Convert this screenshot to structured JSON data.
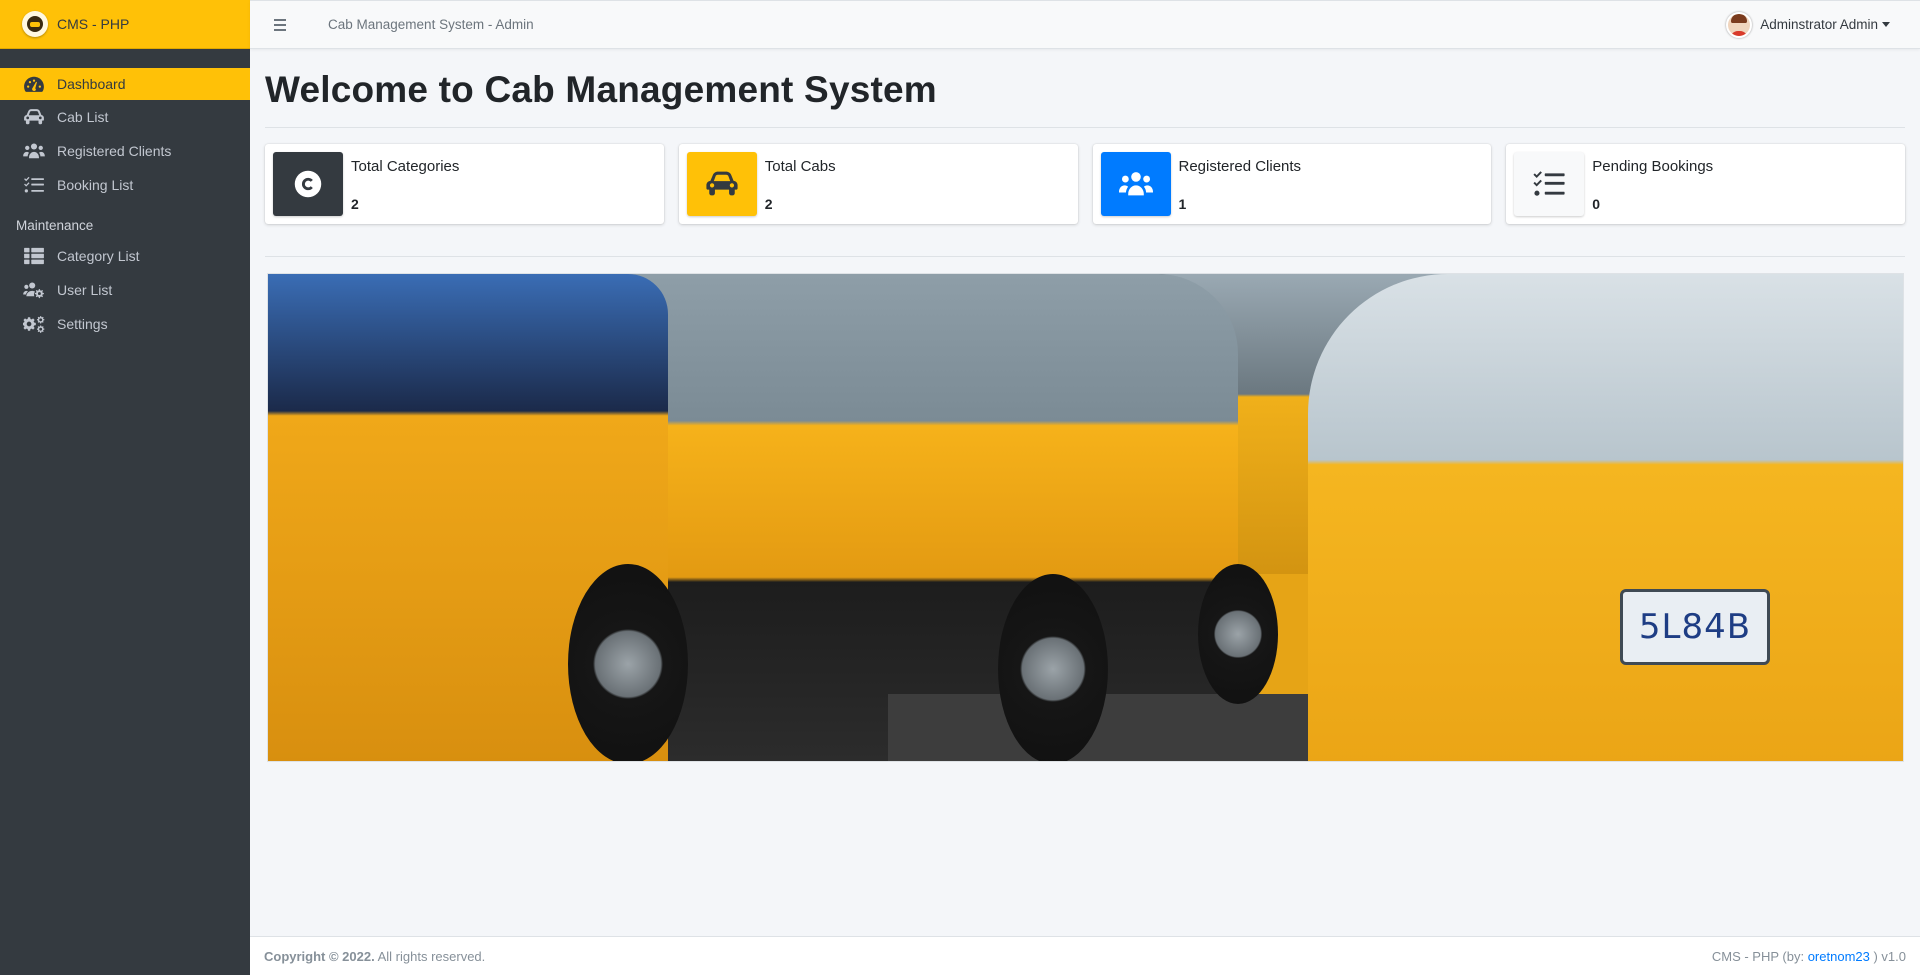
{
  "brand": {
    "name": "CMS - PHP"
  },
  "sidebar": {
    "items": [
      {
        "label": "Dashboard",
        "icon": "tachometer-icon",
        "active": true
      },
      {
        "label": "Cab List",
        "icon": "car-icon"
      },
      {
        "label": "Registered Clients",
        "icon": "users-icon"
      },
      {
        "label": "Booking List",
        "icon": "tasks-icon"
      }
    ],
    "section_header": "Maintenance",
    "maintenance_items": [
      {
        "label": "Category List",
        "icon": "th-list-icon"
      },
      {
        "label": "User List",
        "icon": "users-cog-icon"
      },
      {
        "label": "Settings",
        "icon": "cogs-icon"
      }
    ]
  },
  "topbar": {
    "title": "Cab Management System - Admin",
    "user_name": "Adminstrator Admin"
  },
  "main": {
    "page_title": "Welcome to Cab Management System",
    "info_boxes": [
      {
        "label": "Total Categories",
        "value": "2",
        "icon": "copyright-icon",
        "color": "#343a40"
      },
      {
        "label": "Total Cabs",
        "value": "2",
        "icon": "car-icon",
        "color": "#ffc107"
      },
      {
        "label": "Registered Clients",
        "value": "1",
        "icon": "users-icon",
        "color": "#007bff"
      },
      {
        "label": "Pending Bookings",
        "value": "0",
        "icon": "tasks-icon",
        "color": "#f8f9fa"
      }
    ],
    "banner": {
      "plate_text": "5L84B"
    }
  },
  "footer": {
    "copyright_strong": "Copyright © 2022.",
    "copyright_rest": "All rights reserved.",
    "right_prefix": "CMS - PHP (by:",
    "author_link": "oretnom23",
    "right_suffix": ") v1.0"
  },
  "colors": {
    "accent": "#ffc107",
    "sidebar": "#343a40",
    "primary": "#007bff"
  }
}
